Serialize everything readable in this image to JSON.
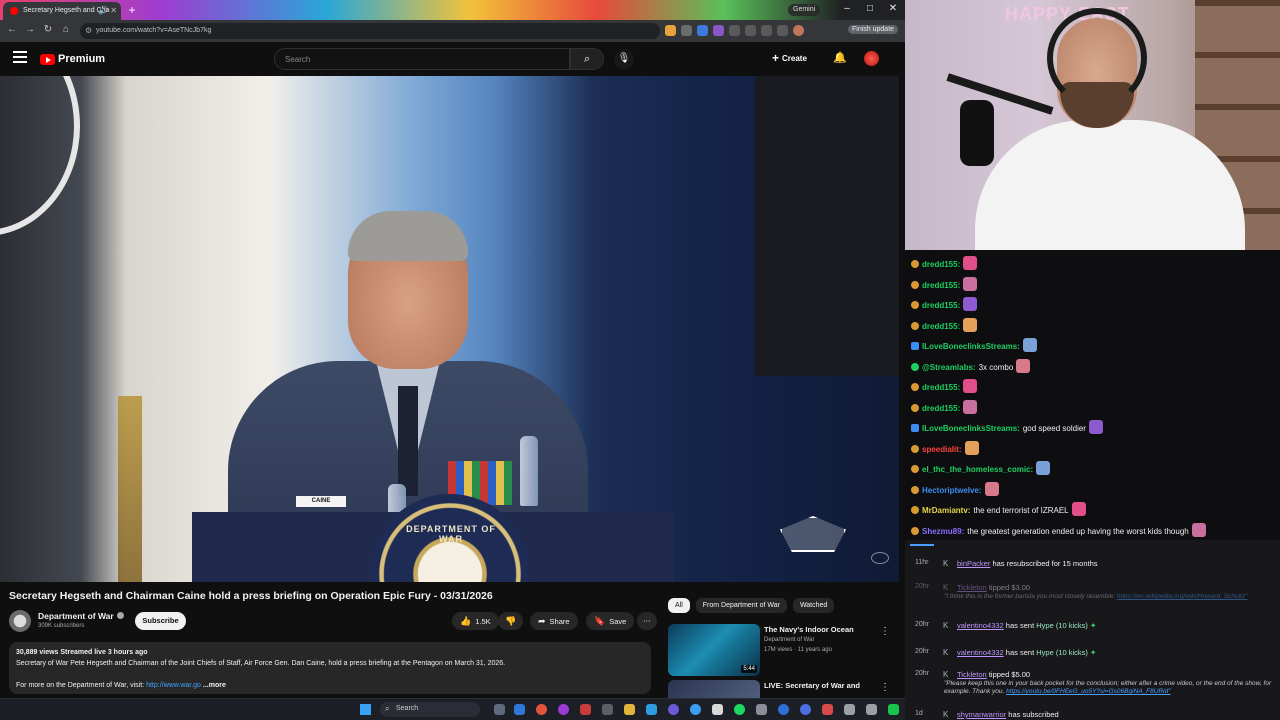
{
  "browser": {
    "tab_title": "Secretary Hegseth and Cha",
    "gemini_label": "Gemini",
    "url": "youtube.com/watch?v=AseTNcJb7kg",
    "finish_update_label": "Finish update"
  },
  "youtube": {
    "brand": "Premium",
    "search_placeholder": "Search",
    "create_label": "Create"
  },
  "video": {
    "nameplate": "CAINE",
    "podium_seal": "DEPARTMENT OF WAR",
    "title": "Secretary Hegseth and Chairman Caine hold a press briefing on Operation Epic Fury - 03/31/2026",
    "channel_name": "Department of War",
    "channel_subs": "309K subscribers",
    "subscribe_label": "Subscribe",
    "likes": "1.5K",
    "share_label": "Share",
    "save_label": "Save",
    "description": {
      "meta": "30,889 views  Streamed live 3 hours ago",
      "line1": "Secretary of War Pete Hegseth and Chairman of the Joint Chiefs of Staff, Air Force Gen. Dan Caine, hold a press briefing at the Pentagon on March 31, 2026.",
      "line2_prefix": "For more on the Department of War, visit: ",
      "link": "http://www.war.go",
      "more": "...more"
    }
  },
  "recommendations": {
    "chips": [
      "All",
      "From Department of War",
      "Watched"
    ],
    "items": [
      {
        "title": "The Navy's Indoor Ocean",
        "channel": "Department of War",
        "views": "17M views · 11 years ago",
        "duration": "5:44"
      },
      {
        "title": "LIVE: Secretary of War and",
        "channel": "",
        "views": "",
        "duration": ""
      }
    ]
  },
  "webcam": {
    "banner": "HAPPY EAST"
  },
  "chat": {
    "messages": [
      {
        "user": "dredd155:",
        "text": "",
        "color": "#1ecf63"
      },
      {
        "user": "dredd155:",
        "text": "",
        "color": "#1ecf63"
      },
      {
        "user": "dredd155:",
        "text": "",
        "color": "#1ecf63"
      },
      {
        "user": "dredd155:",
        "text": "",
        "color": "#1ecf63"
      },
      {
        "user": "ILoveBoneclinksStreams:",
        "text": "",
        "color": "#1ecf63"
      },
      {
        "user": "@Streamlabs:",
        "text": "3x  combo",
        "color": "#1ecf63"
      },
      {
        "user": "dredd155:",
        "text": "",
        "color": "#1ecf63"
      },
      {
        "user": "dredd155:",
        "text": "",
        "color": "#1ecf63"
      },
      {
        "user": "ILoveBoneclinksStreams:",
        "text": "god speed soldier",
        "color": "#1ecf63"
      },
      {
        "user": "speedialit:",
        "text": "",
        "color": "#ff4040"
      },
      {
        "user": "el_thc_the_homeless_comic:",
        "text": "",
        "color": "#1ecf63"
      },
      {
        "user": "Hectoriptwelve:",
        "text": "",
        "color": "#3b8df0"
      },
      {
        "user": "MrDamiantv:",
        "text": "the end terrorist of IZRAEL",
        "color": "#e6d54a"
      },
      {
        "user": "Shezmu89:",
        "text": "the greatest generation ended up having the worst kids though",
        "color": "#8a6cff"
      }
    ]
  },
  "events": [
    {
      "time": "11hr",
      "user": "binPacker",
      "text": " has resubscribed for 15 months",
      "quote": "",
      "dim": false
    },
    {
      "time": "20hr",
      "user": "Tickleton",
      "text": " tipped $3.00",
      "quote": "\"I think this is the former barista you most closely resemble:",
      "quote_link": "https://en.wikipedia.org/wiki/Howard_Schultz\"",
      "dim": true
    },
    {
      "time": "20hr",
      "user": "valentino4332",
      "text": " has sent ",
      "hype": "Hype (10 kicks)",
      "quote": "",
      "dim": false
    },
    {
      "time": "20hr",
      "user": "valentino4332",
      "text": " has sent ",
      "hype": "Hype (10 kicks)",
      "quote": "",
      "dim": false
    },
    {
      "time": "20hr",
      "user": "Tickleton",
      "text": " tipped $5.00",
      "quote": "\"Please keep this one in your back pocket for the conclusion; either after a crime video, or the end of the show, for example. Thank you.",
      "quote_link": "https://youtu.be/0FHEeG_uo5Y?si=Gs06BgiNA_F8URid\"",
      "dim": false
    },
    {
      "time": "1d",
      "user": "shymanwarrior",
      "text": " has subscribed",
      "quote": "",
      "dim": false
    }
  ],
  "taskbar": {
    "search_placeholder": "Search"
  }
}
